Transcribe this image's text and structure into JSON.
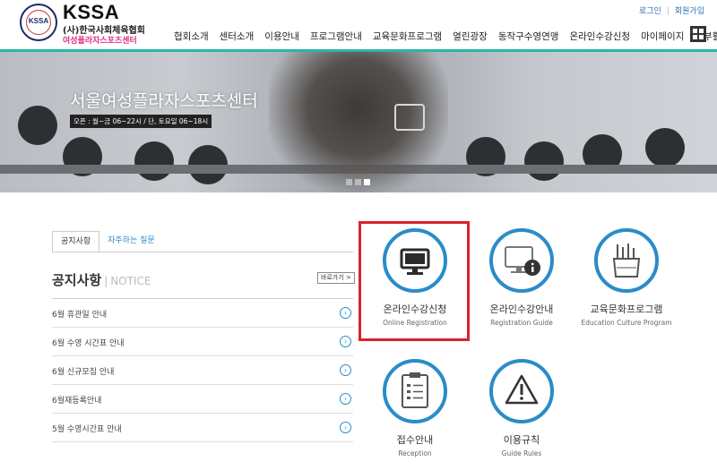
{
  "header": {
    "logo_seal": "KSSA",
    "logo_title": "KSSA",
    "logo_sub1": "(사)한국사회체육협회",
    "logo_sub2": "여성플라자스포츠센터",
    "top_links": {
      "login": "로그인",
      "sep": "|",
      "join": "회원가입"
    },
    "menu": [
      "협회소개",
      "센터소개",
      "이용안내",
      "프로그램안내",
      "교육문화프로그램",
      "열린광장",
      "동작구수영연맹",
      "온라인수강신청",
      "마이페이지",
      "기부활동"
    ]
  },
  "hero": {
    "title": "서울여성플라자스포츠센터",
    "hours": "오픈 : 월~금 06~22시 / 단, 토요일 06~18시"
  },
  "notice": {
    "tabs": [
      "공지사항",
      "자주하는 질문"
    ],
    "heading": "공지사항",
    "heading_sep": "|",
    "heading_en": "NOTICE",
    "more": "바로가기 >",
    "items": [
      "6월 휴관일 안내",
      "6월 수영 시간표 안내",
      "6월 신규모집 안내",
      "6월재등록안내",
      "5월 수영시간표 안내"
    ]
  },
  "quick": [
    {
      "ko": "온라인수강신청",
      "en": "Online Registration",
      "icon": "monitor-icon"
    },
    {
      "ko": "온라인수강안내",
      "en": "Registration Guide",
      "icon": "monitor-info-icon"
    },
    {
      "ko": "교육문화프로그램",
      "en": "Education Culture Program",
      "icon": "pencil-cup-icon"
    },
    {
      "ko": "접수안내",
      "en": "Reception",
      "icon": "clipboard-icon"
    },
    {
      "ko": "이용규칙",
      "en": "Guide Rules",
      "icon": "warning-icon"
    }
  ],
  "colors": {
    "accent": "#2a8cc8",
    "teal_line": "#2bb5a8",
    "highlight": "#d9232a"
  }
}
